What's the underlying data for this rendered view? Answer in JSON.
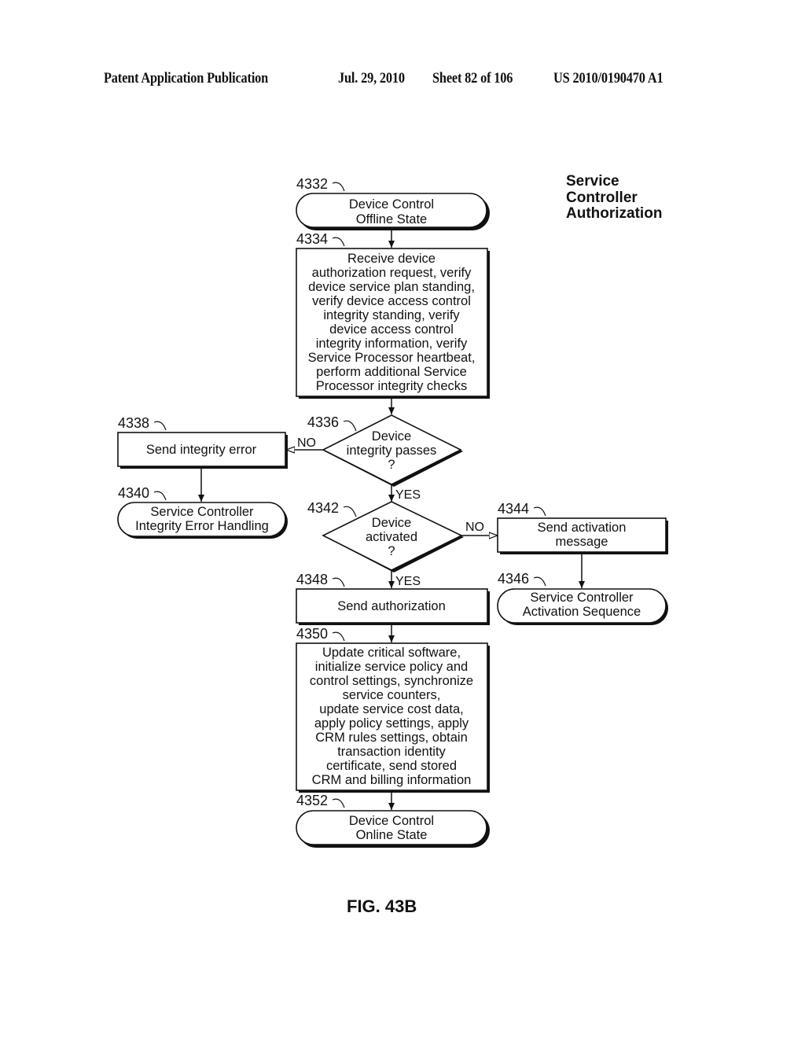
{
  "header": {
    "publication": "Patent Application Publication",
    "date": "Jul. 29, 2010",
    "sheet": "Sheet 82 of 106",
    "number": "US 2010/0190470 A1"
  },
  "diagram": {
    "title": [
      "Service",
      "Controller",
      "Authorization"
    ],
    "figure_label": "FIG. 43B",
    "nodes": {
      "n4332": {
        "ref": "4332",
        "type": "terminal",
        "lines": [
          "Device Control",
          "Offline State"
        ]
      },
      "n4334": {
        "ref": "4334",
        "type": "process",
        "lines": [
          "Receive device",
          "authorization request, verify",
          "device service plan standing,",
          "verify device access control",
          "integrity standing, verify",
          "device access control",
          "integrity information, verify",
          "Service Processor heartbeat,",
          "perform additional Service",
          "Processor integrity checks"
        ]
      },
      "n4336": {
        "ref": "4336",
        "type": "decision",
        "lines": [
          "Device",
          "integrity passes",
          "?"
        ]
      },
      "n4338": {
        "ref": "4338",
        "type": "process",
        "lines": [
          "Send integrity error"
        ]
      },
      "n4340": {
        "ref": "4340",
        "type": "terminal",
        "lines": [
          "Service Controller",
          "Integrity Error Handling"
        ]
      },
      "n4342": {
        "ref": "4342",
        "type": "decision",
        "lines": [
          "Device",
          "activated",
          "?"
        ]
      },
      "n4344": {
        "ref": "4344",
        "type": "process",
        "lines": [
          "Send activation",
          "message"
        ]
      },
      "n4346": {
        "ref": "4346",
        "type": "terminal",
        "lines": [
          "Service Controller",
          "Activation Sequence"
        ]
      },
      "n4348": {
        "ref": "4348",
        "type": "process",
        "lines": [
          "Send authorization"
        ]
      },
      "n4350": {
        "ref": "4350",
        "type": "process",
        "lines": [
          "Update critical software,",
          "initialize service policy and",
          "control settings, synchronize",
          "service counters,",
          "update service cost data,",
          "apply policy settings, apply",
          "CRM rules settings, obtain",
          "transaction identity",
          "certificate, send stored",
          "CRM and billing information"
        ]
      },
      "n4352": {
        "ref": "4352",
        "type": "terminal",
        "lines": [
          "Device Control",
          "Online State"
        ]
      }
    },
    "edges": [
      {
        "from": "4332",
        "to": "4334",
        "label": ""
      },
      {
        "from": "4334",
        "to": "4336",
        "label": ""
      },
      {
        "from": "4336",
        "to": "4338",
        "label": "NO"
      },
      {
        "from": "4338",
        "to": "4340",
        "label": ""
      },
      {
        "from": "4336",
        "to": "4342",
        "label": "YES"
      },
      {
        "from": "4342",
        "to": "4344",
        "label": "NO"
      },
      {
        "from": "4344",
        "to": "4346",
        "label": ""
      },
      {
        "from": "4342",
        "to": "4348",
        "label": "YES"
      },
      {
        "from": "4348",
        "to": "4350",
        "label": ""
      },
      {
        "from": "4350",
        "to": "4352",
        "label": ""
      }
    ]
  }
}
